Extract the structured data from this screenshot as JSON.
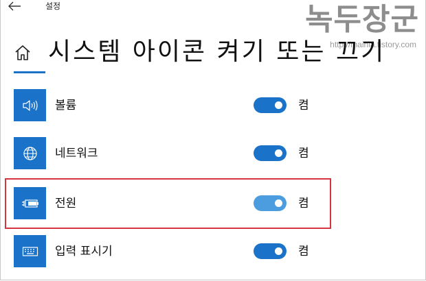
{
  "window": {
    "title": "설정"
  },
  "watermark": {
    "title": "녹두장군",
    "url": "http://mainia.tistory.com"
  },
  "page": {
    "title": "시스템 아이콘 켜기 또는 끄기"
  },
  "items": [
    {
      "label": "볼륨",
      "state": "켬",
      "icon": "volume-icon"
    },
    {
      "label": "네트워크",
      "state": "켬",
      "icon": "globe-icon"
    },
    {
      "label": "전원",
      "state": "켬",
      "icon": "battery-icon"
    },
    {
      "label": "입력 표시기",
      "state": "켬",
      "icon": "keyboard-icon"
    }
  ],
  "colors": {
    "accent": "#1a73c9",
    "accent_light": "#4c9de0",
    "highlight": "#d5333f",
    "watermark": "#8d8d8d"
  }
}
